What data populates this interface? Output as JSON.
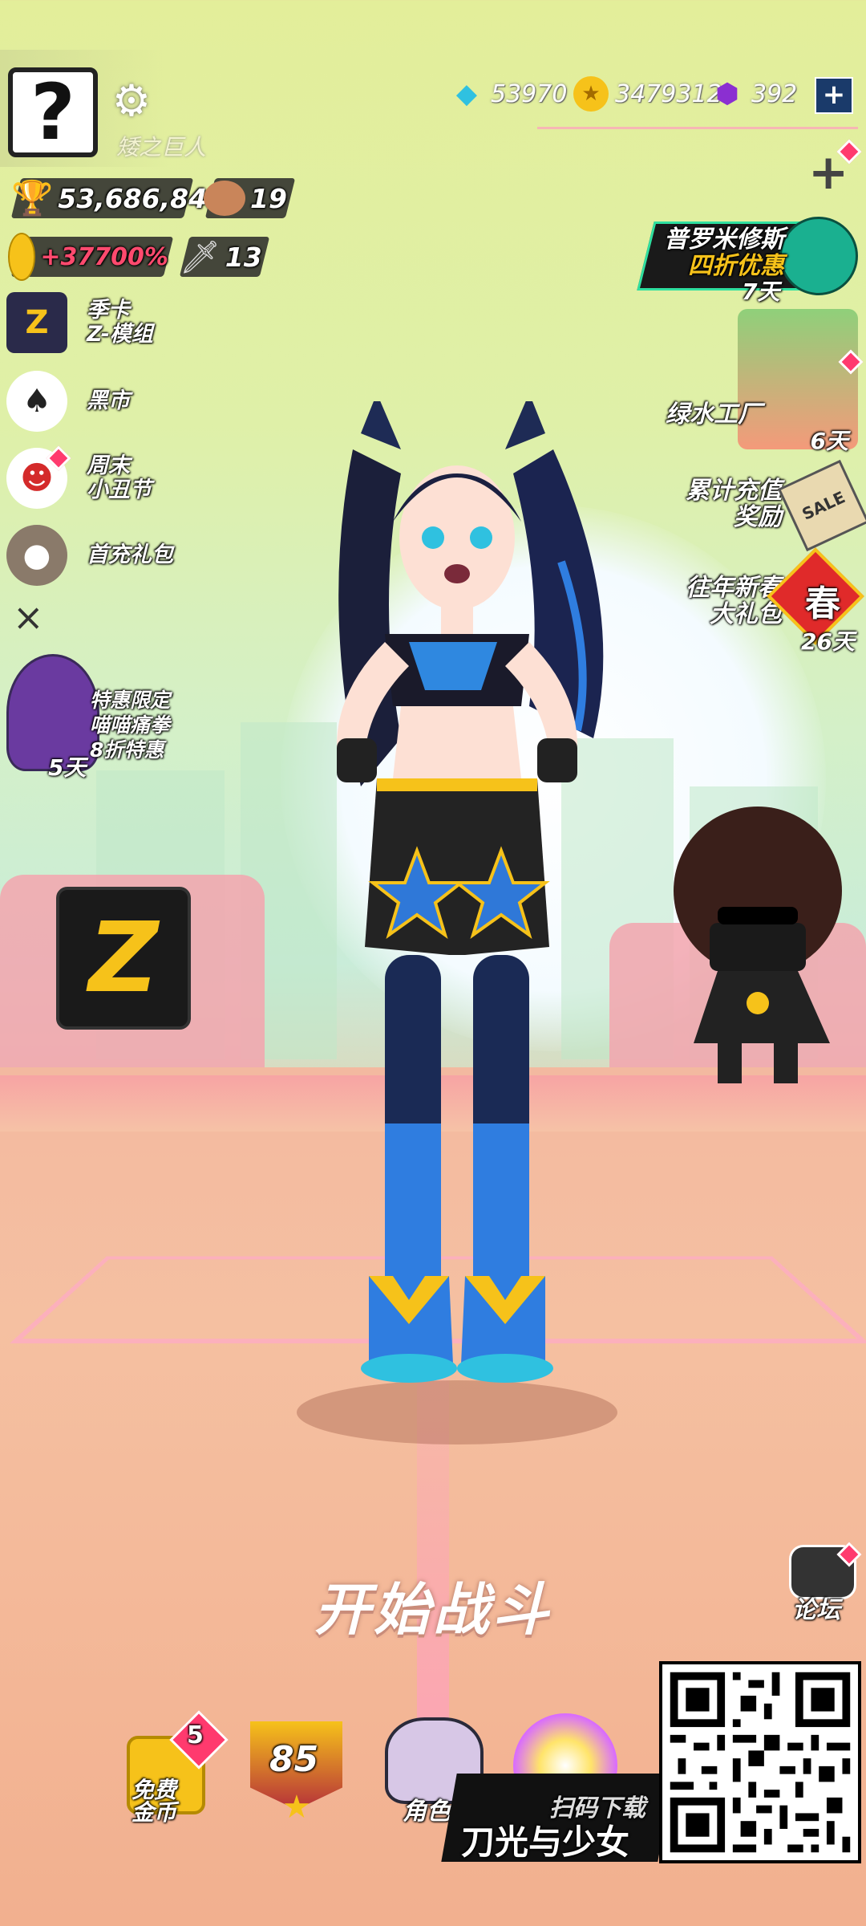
{
  "player": {
    "avatar_symbol": "?",
    "name": "矮之巨人",
    "trophies": "53,686,843",
    "bear_count": "19",
    "boost_percent": "+37700%",
    "sword_count": "13"
  },
  "currencies": {
    "diamonds": "53970",
    "gold": "3479312",
    "crystals": "392",
    "add_label": "+"
  },
  "left_menu": [
    {
      "label_line1": "季卡",
      "label_line2": "Z-模组",
      "icon": "z-card-icon"
    },
    {
      "label_line1": "黑市",
      "label_line2": "",
      "icon": "spade-icon"
    },
    {
      "label_line1": "周末",
      "label_line2": "小丑节",
      "icon": "clown-icon"
    },
    {
      "label_line1": "首充礼包",
      "label_line2": "",
      "icon": "gift-bag-icon"
    }
  ],
  "close_symbol": "×",
  "promo_left": {
    "line1": "特惠限定",
    "line2": "喵喵痛拳",
    "line3": "8折特惠",
    "days": "5天"
  },
  "right_events": [
    {
      "line1": "普罗米修斯",
      "line2": "四折优惠",
      "days": "7天"
    },
    {
      "line1": "绿水工厂",
      "line2": "",
      "days": "6天"
    },
    {
      "line1": "累计充值",
      "line2": "奖励",
      "days": "",
      "tag": "SALE"
    },
    {
      "line1": "往年新春",
      "line2": "大礼包",
      "days": "26天",
      "tag": "春"
    }
  ],
  "forum_label": "论坛",
  "start_button": "开始战斗",
  "bottom_bar": {
    "free_gold_line1": "免费",
    "free_gold_line2": "金币",
    "free_gold_badge": "5",
    "level": "85",
    "character_label": "角色"
  },
  "download": {
    "scan_label": "扫码下载",
    "game_name": "刀光与少女"
  },
  "colors": {
    "accent_pink": "#ff3a6e",
    "gold": "#f6c21a",
    "purple": "#8b2fd1",
    "cyan": "#2fc1e0"
  }
}
